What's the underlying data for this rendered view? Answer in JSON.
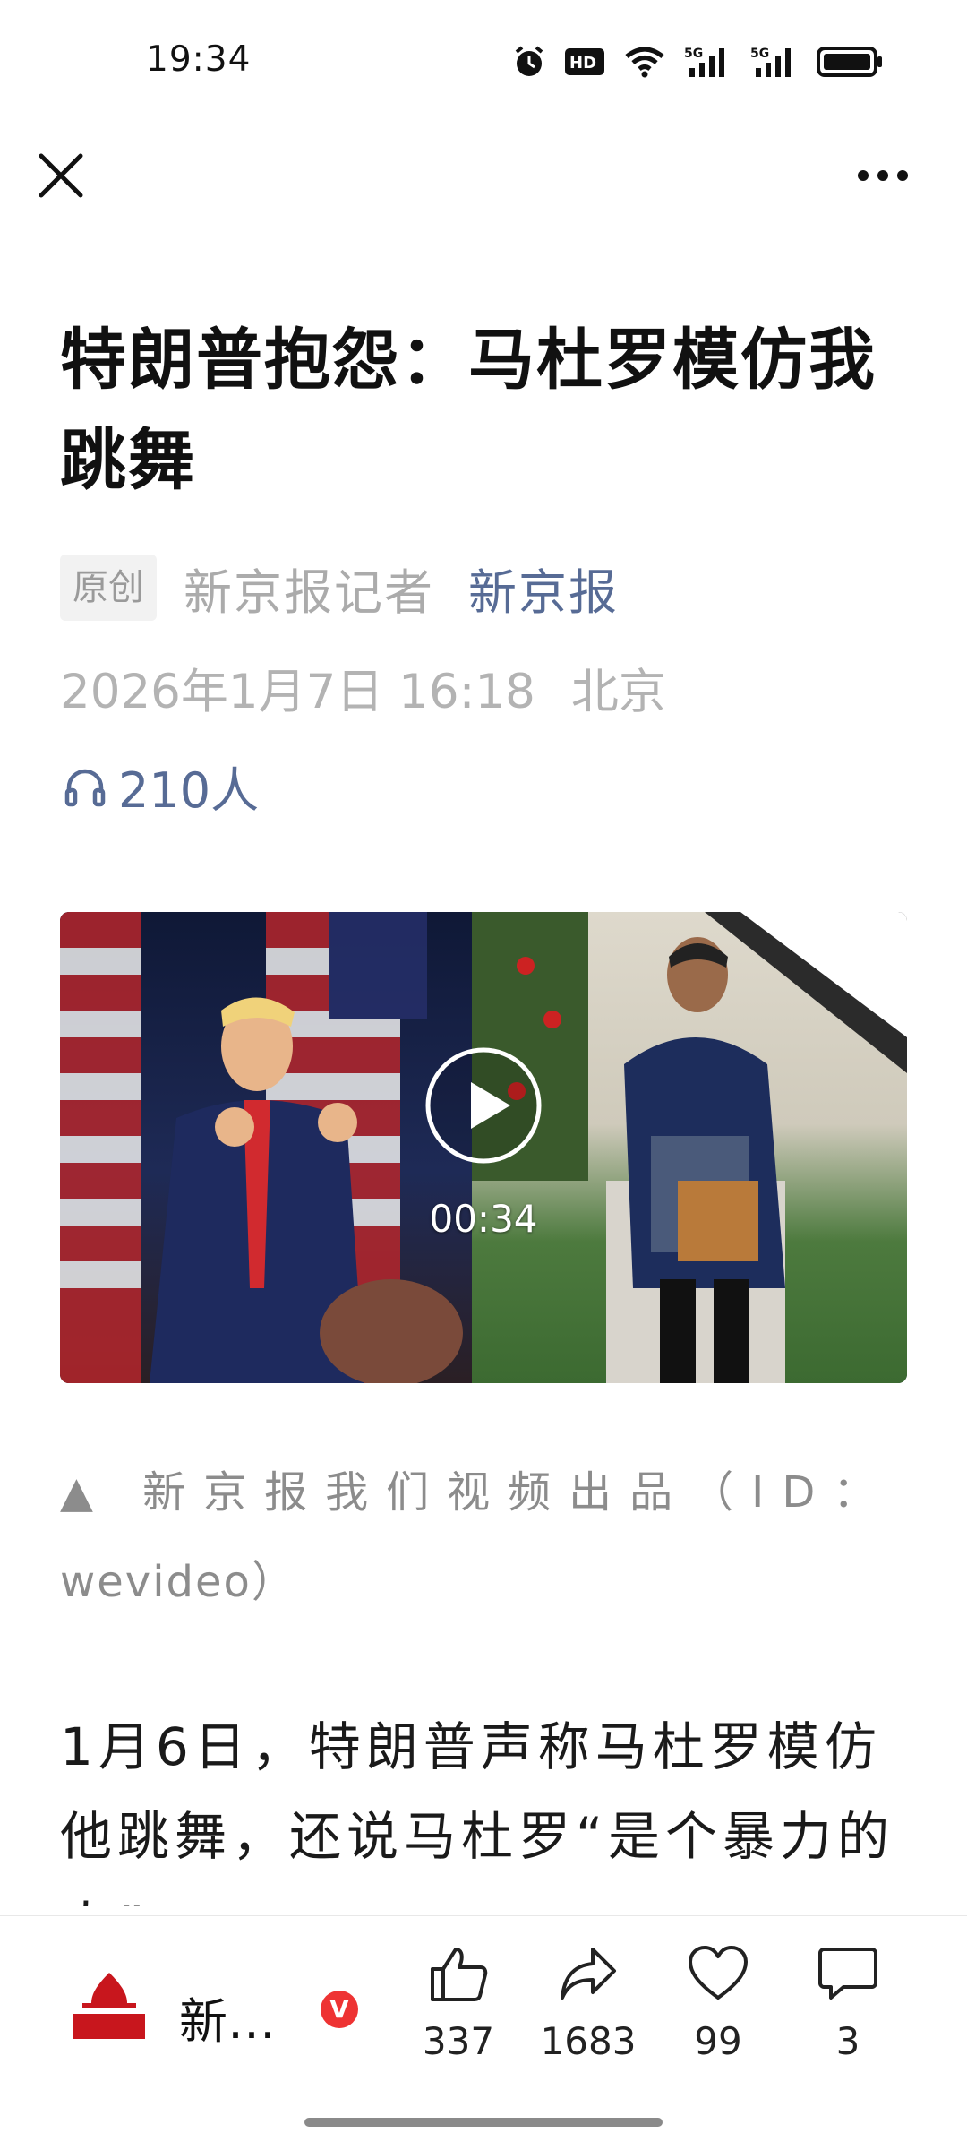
{
  "status_bar": {
    "time": "19:34",
    "icons": [
      "alarm-icon",
      "hd-icon",
      "wifi-icon",
      "signal-5g-icon",
      "signal-5g-icon",
      "battery-icon"
    ]
  },
  "article": {
    "title": "特朗普抱怨：马杜罗模仿我跳舞",
    "original_badge": "原创",
    "reporter": "新京报记者",
    "source": "新京报",
    "date": "2026年1月7日 16:18",
    "location": "北京",
    "listeners": "210人",
    "video": {
      "duration": "00:34"
    },
    "caption": "▲ 新京报我们视频出品（ID：",
    "caption_tail": "wevideo）",
    "body": "1月6日，特朗普声称马杜罗模仿他跳舞，还说马杜罗“是个暴力的人”"
  },
  "toolbar": {
    "account_name": "新…",
    "verified": "V",
    "logo_text": "新京报",
    "like_count": "337",
    "share_count": "1683",
    "favorite_count": "99",
    "comment_count": "3"
  },
  "colors": {
    "link_blue": "#576b95",
    "meta_gray": "#b3b3b3",
    "badge_red": "#e33333"
  }
}
